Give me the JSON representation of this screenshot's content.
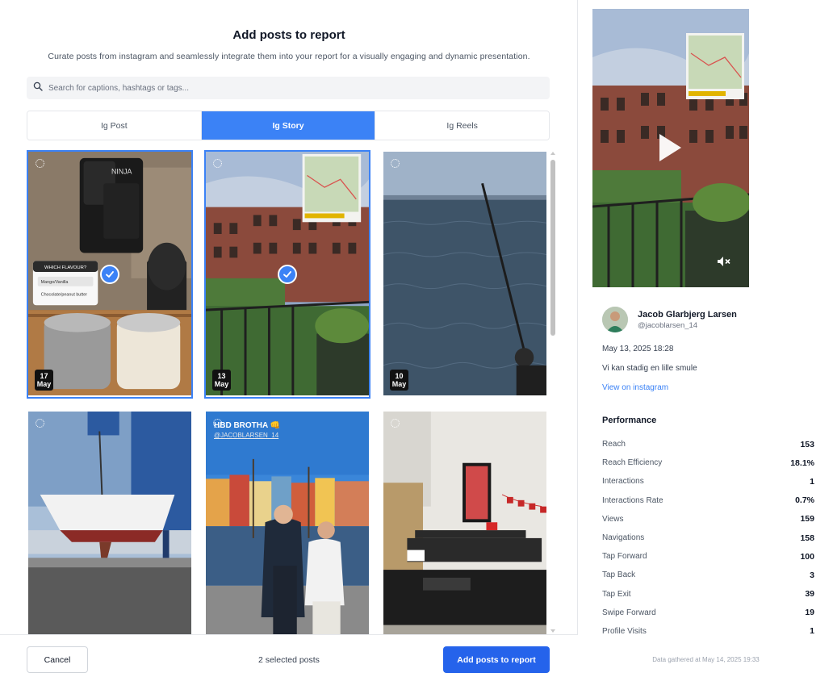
{
  "header": {
    "title": "Add posts to report",
    "subtitle": "Curate posts from instagram and seamlessly integrate them into your report for a visually engaging and dynamic presentation."
  },
  "search": {
    "placeholder": "Search for captions, hashtags or tags..."
  },
  "tabs": [
    {
      "label": "Ig Post",
      "active": false
    },
    {
      "label": "Ig Story",
      "active": true
    },
    {
      "label": "Ig Reels",
      "active": false
    }
  ],
  "posts": [
    {
      "day": "17",
      "month": "May",
      "selected": true,
      "scene": "kitchen"
    },
    {
      "day": "13",
      "month": "May",
      "selected": true,
      "scene": "balcony"
    },
    {
      "day": "10",
      "month": "May",
      "selected": false,
      "scene": "sea"
    },
    {
      "day": "",
      "month": "",
      "selected": false,
      "scene": "boat"
    },
    {
      "day": "",
      "month": "",
      "selected": false,
      "scene": "city",
      "caption": "HBD BROTHA 👊",
      "caption2": "@JACOBLARSEN_14"
    },
    {
      "day": "",
      "month": "",
      "selected": false,
      "scene": "office"
    }
  ],
  "kitchen_overlay": {
    "brand": "NINJA",
    "menu_title": "WHICH FLAVOUR?",
    "option1": "Mango/Vanilla",
    "option2": "Chocolate/peanut butter"
  },
  "footer": {
    "cancel_label": "Cancel",
    "selected_text": "2 selected posts",
    "add_label": "Add posts to report"
  },
  "detail": {
    "name": "Jacob Glarbjerg Larsen",
    "handle": "@jacoblarsen_14",
    "date": "May 13, 2025 18:28",
    "caption": "Vi kan stadig en lille smule",
    "link_label": "View on instagram",
    "performance_title": "Performance",
    "metrics": [
      {
        "label": "Reach",
        "value": "153"
      },
      {
        "label": "Reach Efficiency",
        "value": "18.1%"
      },
      {
        "label": "Interactions",
        "value": "1"
      },
      {
        "label": "Interactions Rate",
        "value": "0.7%"
      },
      {
        "label": "Views",
        "value": "159"
      },
      {
        "label": "Navigations",
        "value": "158"
      },
      {
        "label": "Tap Forward",
        "value": "100"
      },
      {
        "label": "Tap Back",
        "value": "3"
      },
      {
        "label": "Tap Exit",
        "value": "39"
      },
      {
        "label": "Swipe Forward",
        "value": "19"
      },
      {
        "label": "Profile Visits",
        "value": "1"
      }
    ],
    "gathered": "Data gathered at May 14, 2025 19:33"
  },
  "colors": {
    "accent": "#3b82f6",
    "primary_button": "#2563eb"
  }
}
